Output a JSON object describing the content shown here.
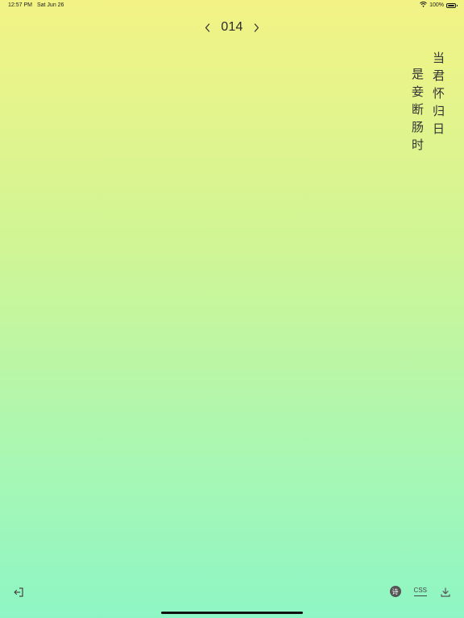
{
  "status_bar": {
    "time": "12:57 PM",
    "date": "Sat Jun 26",
    "battery": "100%",
    "battery_level": 1.0,
    "wifi_icon": "wifi-icon"
  },
  "pager": {
    "number": "014",
    "prev_icon": "chevron-left-icon",
    "next_icon": "chevron-right-icon"
  },
  "poem": {
    "lines": [
      "当君怀归日",
      "是妾断肠时"
    ]
  },
  "bottom_bar": {
    "exit_icon": "exit-icon",
    "poem_badge": "诗",
    "css_tab": "CSS",
    "download_icon": "download-icon"
  }
}
